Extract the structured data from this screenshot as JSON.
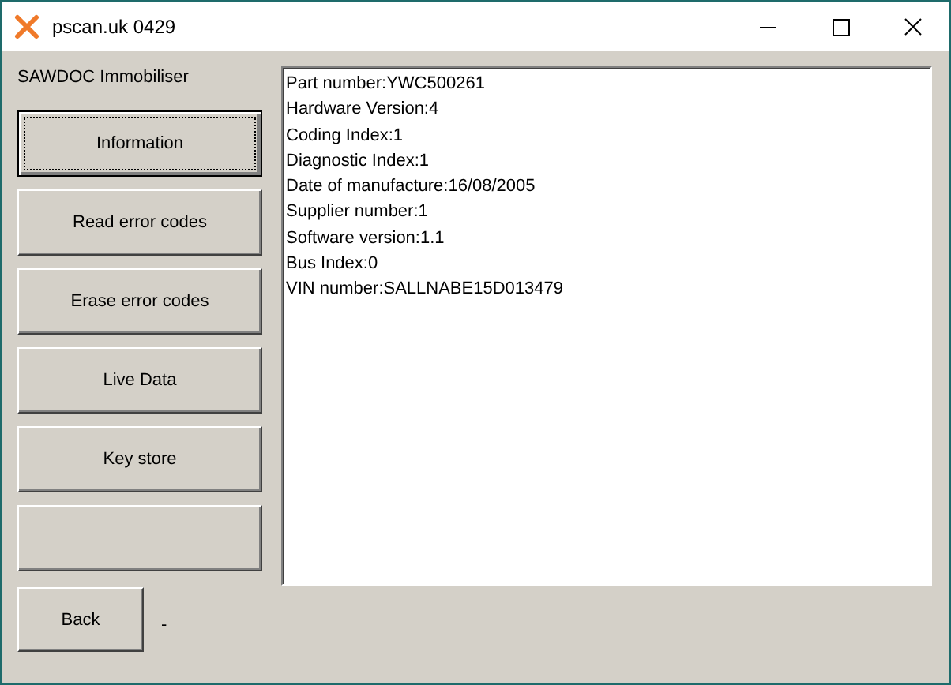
{
  "window": {
    "title": "pscan.uk 0429"
  },
  "module_label": "SAWDOC Immobiliser",
  "buttons": [
    {
      "kind": "labeled",
      "label": "Information",
      "selected": true
    },
    {
      "kind": "labeled",
      "label": "Read error codes",
      "selected": false
    },
    {
      "kind": "labeled",
      "label": "Erase error codes",
      "selected": false
    },
    {
      "kind": "labeled",
      "label": "Live Data",
      "selected": false
    },
    {
      "kind": "labeled",
      "label": "Key store",
      "selected": false
    },
    {
      "kind": "blank",
      "selected": false
    }
  ],
  "output_lines": [
    "Part number:YWC500261",
    "Hardware Version:4",
    "Coding Index:1",
    "Diagnostic Index:1",
    "Date of manufacture:16/08/2005",
    "Supplier number:1",
    "Software version:1.1",
    "Bus Index:0",
    "VIN number:SALLNABE15D013479"
  ],
  "back_button": "Back",
  "status": "-"
}
